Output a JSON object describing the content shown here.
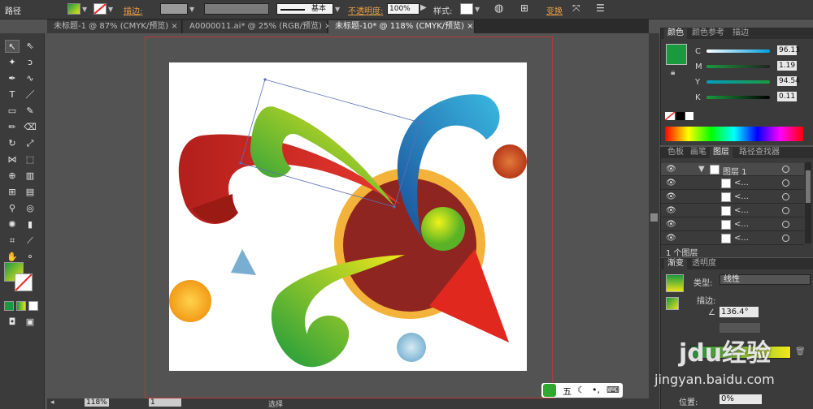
{
  "control_bar": {
    "object_type": "路径",
    "stroke_label": "描边:",
    "stroke_style": "基本",
    "opacity_label": "不透明度:",
    "opacity_value": "100%",
    "style_label": "样式:",
    "transform_label": "变换"
  },
  "tabs": [
    {
      "label": "未标题-1 @ 87% (CMYK/预览)",
      "close": "×"
    },
    {
      "label": "A0000011.ai* @ 25% (RGB/预览)",
      "close": "×"
    },
    {
      "label": "未标题-10* @ 118% (CMYK/预览)",
      "close": "×"
    }
  ],
  "status_bar": {
    "zoom": "118%",
    "page": "1",
    "mode": "选择"
  },
  "color_panel": {
    "tabs": [
      "颜色",
      "颜色参考",
      "描边"
    ],
    "channels": [
      {
        "name": "C",
        "value": "96.13"
      },
      {
        "name": "M",
        "value": "1.19"
      },
      {
        "name": "Y",
        "value": "94.54"
      },
      {
        "name": "K",
        "value": "0.11"
      }
    ],
    "current_color": "#1a9a3e"
  },
  "layers_panel": {
    "tabs": [
      "色板",
      "画笔",
      "图层",
      "路径查找器"
    ],
    "layer_name": "图层 1",
    "sublayers": [
      "<...",
      "<...",
      "<...",
      "<...",
      "<..."
    ],
    "footer": "1 个图层"
  },
  "gradient_panel": {
    "tabs": [
      "渐变",
      "透明度"
    ],
    "type_label": "类型:",
    "type_value": "线性",
    "stroke_label": "描边:",
    "angle_value": "136.4°",
    "position_label": "位置:",
    "position_value": "0%"
  },
  "watermark": {
    "brand": "jdu经验",
    "url": "jingyan.baidu.com"
  },
  "ime": {
    "label": "五"
  },
  "colors": {
    "accent": "#e8a046",
    "red": "#d52a24",
    "yellow_green": "#b8d21a",
    "blue": "#1a8ac7",
    "dark_red": "#8e2520"
  }
}
